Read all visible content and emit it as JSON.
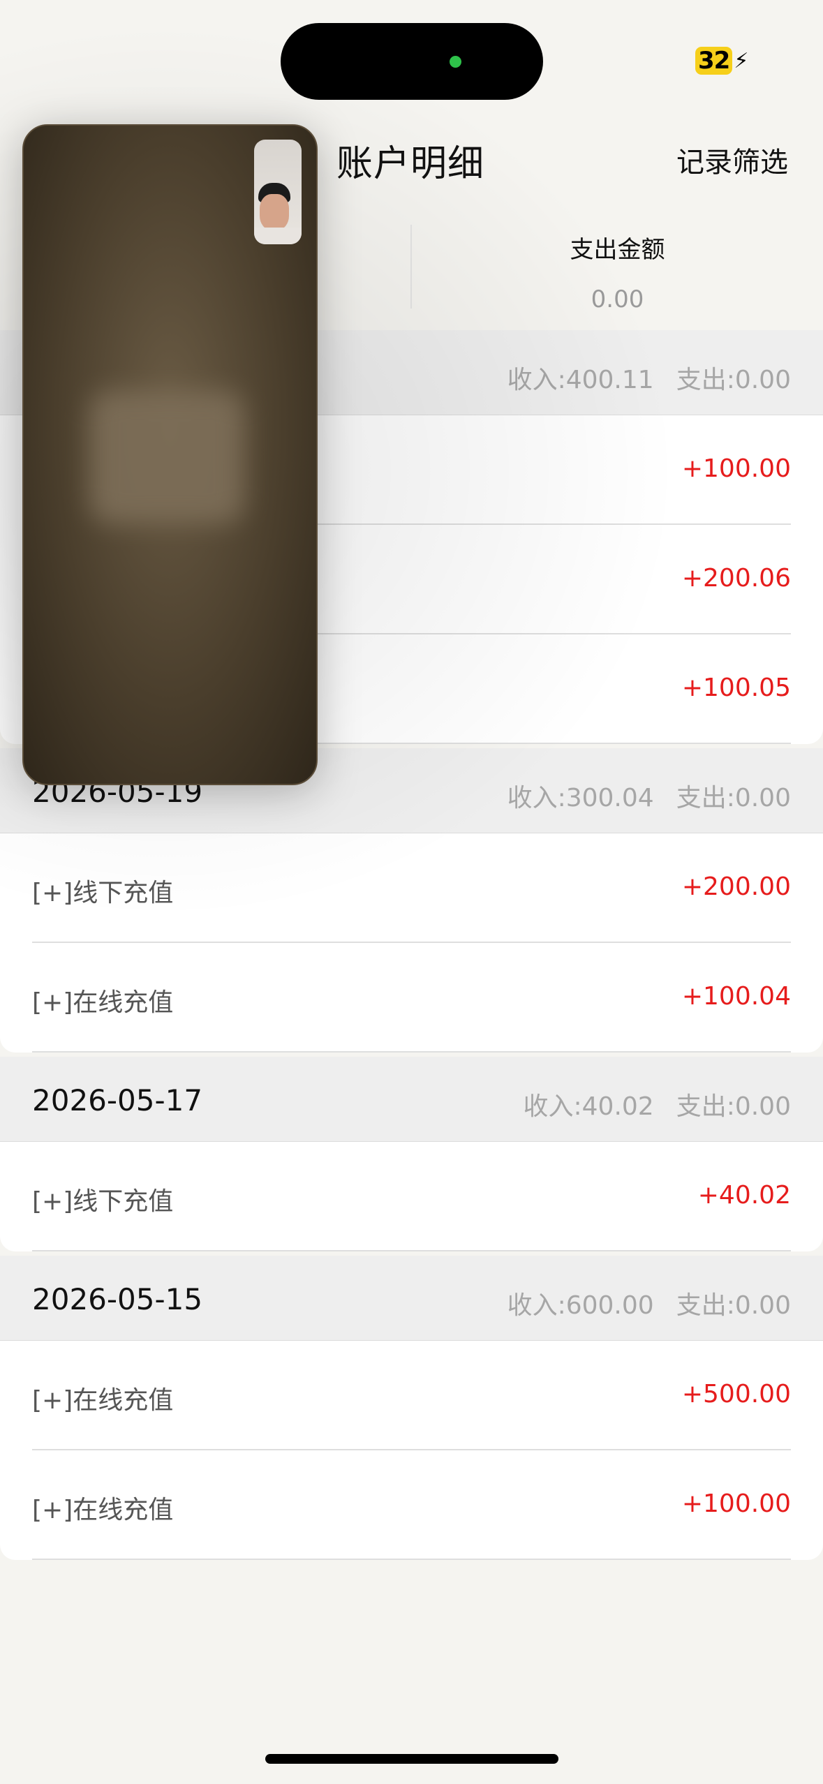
{
  "status_bar": {
    "battery_level": "32",
    "battery_color": "#f6cf1a"
  },
  "header": {
    "title": "账户明细",
    "filter_label": "记录筛选"
  },
  "summary": {
    "expense_label": "支出金额",
    "expense_value": "0.00"
  },
  "groups": [
    {
      "date": "",
      "income": "收入:400.11",
      "expense": "支出:0.00",
      "rows": [
        {
          "desc": "",
          "amount": "+100.00"
        },
        {
          "desc": "",
          "amount": "+200.06"
        },
        {
          "desc": "",
          "amount": "+100.05"
        }
      ]
    },
    {
      "date": "2026-05-19",
      "income": "收入:300.04",
      "expense": "支出:0.00",
      "rows": [
        {
          "desc": "[+]线下充值",
          "amount": "+200.00"
        },
        {
          "desc": "[+]在线充值",
          "amount": "+100.04"
        }
      ]
    },
    {
      "date": "2026-05-17",
      "income": "收入:40.02",
      "expense": "支出:0.00",
      "rows": [
        {
          "desc": "[+]线下充值",
          "amount": "+40.02"
        }
      ]
    },
    {
      "date": "2026-05-15",
      "income": "收入:600.00",
      "expense": "支出:0.00",
      "rows": [
        {
          "desc": "[+]在线充值",
          "amount": "+500.00"
        },
        {
          "desc": "[+]在线充值",
          "amount": "+100.00"
        }
      ]
    }
  ],
  "colors": {
    "amount": "#e61c1c",
    "group_header_bg": "#eeeeee",
    "page_bg": "#f5f4f0"
  },
  "icons": {
    "battery": "battery-icon",
    "charging": "bolt-icon",
    "camera_indicator": "camera-dot-icon"
  }
}
